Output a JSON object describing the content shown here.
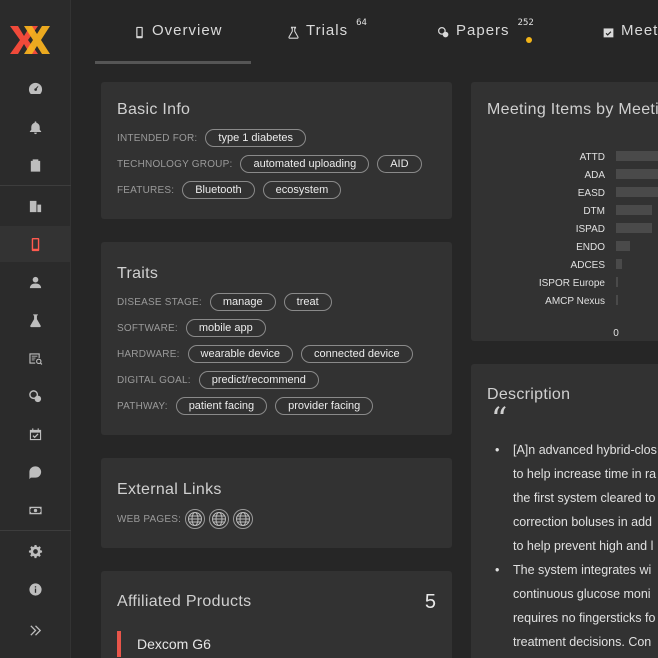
{
  "tabs": [
    {
      "label": "Overview",
      "count": ""
    },
    {
      "label": "Trials",
      "count": "64"
    },
    {
      "label": "Papers",
      "count": "252"
    },
    {
      "label": "Meet",
      "count": ""
    }
  ],
  "basic_info": {
    "title": "Basic Info",
    "rows": [
      {
        "label": "INTENDED FOR:",
        "chips": [
          "type 1 diabetes"
        ]
      },
      {
        "label": "TECHNOLOGY GROUP:",
        "chips": [
          "automated uploading",
          "AID"
        ]
      },
      {
        "label": "FEATURES:",
        "chips": [
          "Bluetooth",
          "ecosystem"
        ]
      }
    ]
  },
  "traits": {
    "title": "Traits",
    "rows": [
      {
        "label": "DISEASE STAGE:",
        "chips": [
          "manage",
          "treat"
        ]
      },
      {
        "label": "SOFTWARE:",
        "chips": [
          "mobile app"
        ]
      },
      {
        "label": "HARDWARE:",
        "chips": [
          "wearable device",
          "connected device"
        ]
      },
      {
        "label": "DIGITAL GOAL:",
        "chips": [
          "predict/recommend"
        ]
      },
      {
        "label": "PATHWAY:",
        "chips": [
          "patient facing",
          "provider facing"
        ]
      }
    ]
  },
  "external_links": {
    "title": "External Links",
    "label": "WEB PAGES:",
    "links": [
      "globe-icon",
      "globe-icon",
      "globe-icon"
    ]
  },
  "affiliated": {
    "title": "Affiliated Products",
    "count": "5",
    "first_product": "Dexcom G6"
  },
  "meeting_chart": {
    "title": "Meeting Items by Meeti",
    "zero_label": "0"
  },
  "chart_data": {
    "type": "bar",
    "orientation": "horizontal",
    "title": "Meeting Items by Meeti",
    "categories": [
      "ATTD",
      "ADA",
      "EASD",
      "DTM",
      "ISPAD",
      "ENDO",
      "ADCES",
      "ISPOR Europe",
      "AMCP Nexus"
    ],
    "values": [
      45,
      44,
      37,
      18,
      18,
      7,
      3,
      1,
      1
    ],
    "xlim": [
      0,
      50
    ],
    "x_tick_labels": [
      "0"
    ],
    "bar_color": "#4a4a4a"
  },
  "description": {
    "title": "Description",
    "items": [
      [
        "[A]n advanced hybrid-clos",
        "to help increase time in ra",
        "the first system cleared to",
        "correction boluses in add",
        "to help prevent high and l"
      ],
      [
        "The system integrates wi",
        "continuous glucose moni",
        "requires no fingersticks fo",
        "treatment decisions. Con"
      ]
    ]
  },
  "colors": {
    "accent": "#ff5a4f",
    "notify_dot": "#f2b418",
    "product_marker": "#e8554a"
  }
}
